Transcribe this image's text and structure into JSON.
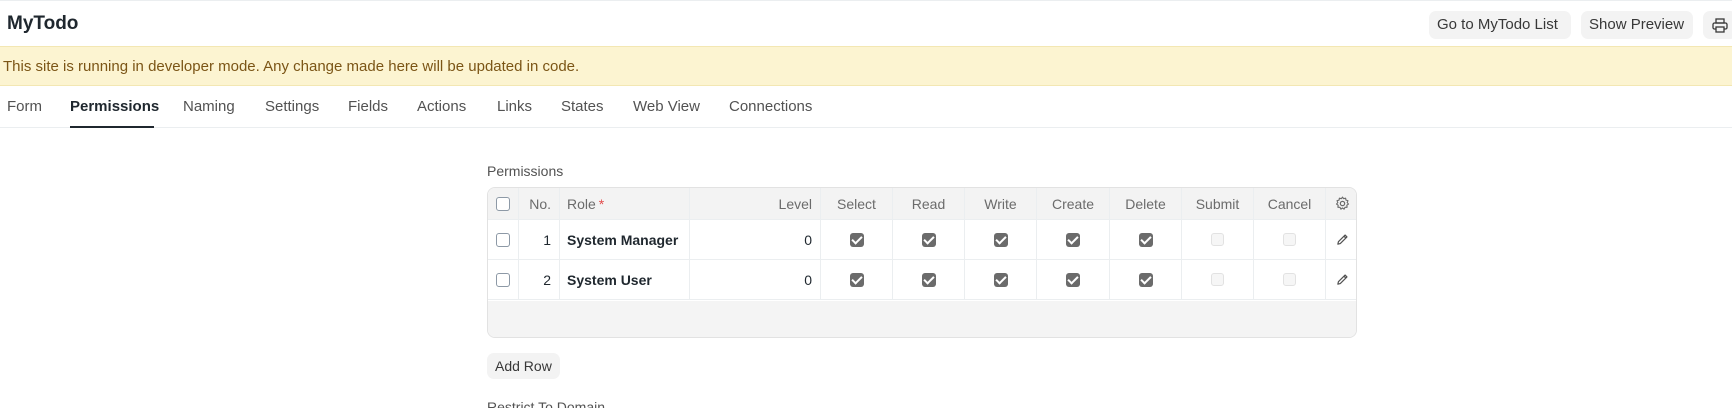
{
  "header": {
    "title": "MyTodo",
    "go_to_list_label": "Go to MyTodo List",
    "show_preview_label": "Show Preview",
    "print_icon": "printer-icon"
  },
  "dev_banner": {
    "text": "This site is running in developer mode. Any change made here will be updated in code."
  },
  "tabs": [
    {
      "label": "Form"
    },
    {
      "label": "Permissions",
      "active": true
    },
    {
      "label": "Naming"
    },
    {
      "label": "Settings"
    },
    {
      "label": "Fields"
    },
    {
      "label": "Actions"
    },
    {
      "label": "Links"
    },
    {
      "label": "States"
    },
    {
      "label": "Web View"
    },
    {
      "label": "Connections"
    }
  ],
  "permissions": {
    "section_label": "Permissions",
    "columns": {
      "no": "No.",
      "role": "Role",
      "required_mark": "*",
      "level": "Level",
      "select": "Select",
      "read": "Read",
      "write": "Write",
      "create": "Create",
      "delete": "Delete",
      "submit": "Submit",
      "cancel": "Cancel"
    },
    "rows": [
      {
        "no": "1",
        "role": "System Manager",
        "level": "0",
        "select": true,
        "read": true,
        "write": true,
        "create": true,
        "delete": true,
        "submit": false,
        "cancel": false
      },
      {
        "no": "2",
        "role": "System User",
        "level": "0",
        "select": true,
        "read": true,
        "write": true,
        "create": true,
        "delete": true,
        "submit": false,
        "cancel": false
      }
    ],
    "add_row_label": "Add Row"
  },
  "next_section_label": "Restrict To Domain",
  "colors": {
    "banner_bg": "#fcf4d1",
    "banner_text": "#7b5516",
    "checkbox_checked": "#6b6b6b"
  }
}
